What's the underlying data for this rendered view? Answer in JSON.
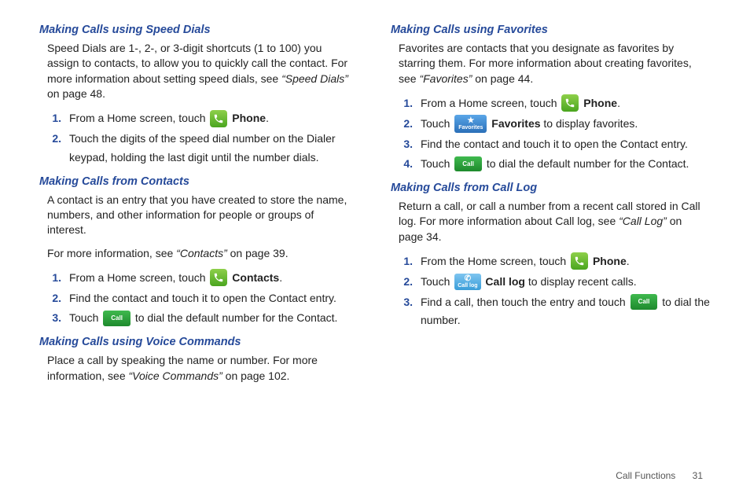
{
  "footer": {
    "section": "Call Functions",
    "page": "31"
  },
  "icons": {
    "call": "Call",
    "favorites": "Favorites",
    "calllog": "Call log"
  },
  "left": {
    "s1": {
      "title": "Making Calls using Speed Dials",
      "para_a": "Speed Dials are 1-, 2-, or 3-digit shortcuts (1 to 100) you assign to contacts, to allow you to quickly call the contact. For more information about setting speed dials, see ",
      "ref": "“Speed Dials”",
      "para_b": " on page 48.",
      "step1_a": "From a Home screen, touch ",
      "step1_b": "Phone",
      "step1_c": ".",
      "step2": "Touch the digits of the speed dial number on the Dialer keypad, holding the last digit until the number dials."
    },
    "s2": {
      "title": "Making Calls from Contacts",
      "para": "A contact is an entry that you have created to store the name, numbers, and other information for people or groups of interest.",
      "para2_a": "For more information, see ",
      "para2_ref": "“Contacts”",
      "para2_b": " on page 39.",
      "step1_a": "From a Home screen, touch ",
      "step1_b": "Contacts",
      "step1_c": ".",
      "step2": "Find the contact and touch it to open the Contact entry.",
      "step3_a": "Touch ",
      "step3_b": " to dial the default number for the Contact."
    },
    "s3": {
      "title": "Making Calls using Voice Commands",
      "para_a": "Place a call by speaking the name or number. For more information, see ",
      "ref": "“Voice Commands”",
      "para_b": " on page 102."
    }
  },
  "right": {
    "s1": {
      "title": "Making Calls using Favorites",
      "para_a": "Favorites are contacts that you designate as favorites by starring them. For more information about creating favorites, see ",
      "ref": "“Favorites”",
      "para_b": " on page 44.",
      "step1_a": "From a Home screen, touch ",
      "step1_b": "Phone",
      "step1_c": ".",
      "step2_a": "Touch ",
      "step2_b": "Favorites",
      "step2_c": " to display favorites.",
      "step3": "Find the contact and touch it to open the Contact entry.",
      "step4_a": "Touch ",
      "step4_b": " to dial the default number for the Contact."
    },
    "s2": {
      "title": "Making Calls from Call Log",
      "para_a": "Return a call, or call a number from a recent call stored in Call log. For more information about Call log, see ",
      "ref": "“Call Log”",
      "para_b": " on page 34.",
      "step1_a": "From the Home screen, touch ",
      "step1_b": "Phone",
      "step1_c": ".",
      "step2_a": "Touch ",
      "step2_b": "Call log",
      "step2_c": " to display recent calls.",
      "step3_a": "Find a call, then touch the entry and touch ",
      "step3_b": " to dial the number."
    }
  }
}
